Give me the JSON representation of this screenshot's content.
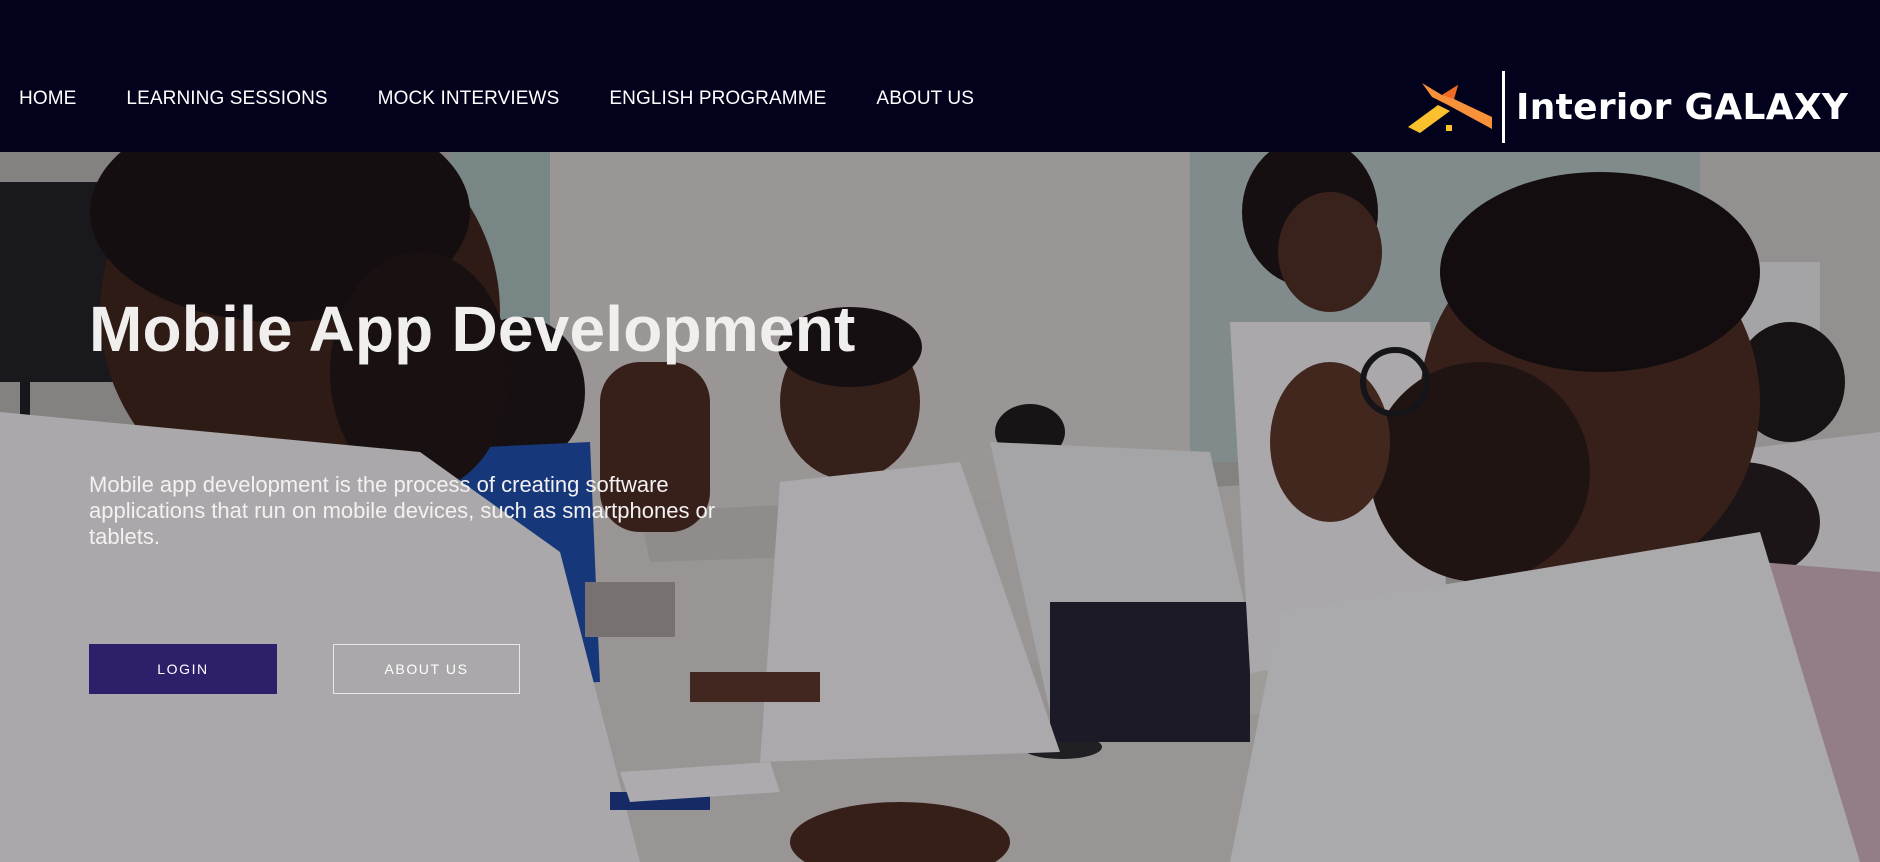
{
  "nav": {
    "items": [
      {
        "label": "HOME"
      },
      {
        "label": "LEARNING SESSIONS"
      },
      {
        "label": "MOCK INTERVIEWS"
      },
      {
        "label": "ENGLISH PROGRAMME"
      },
      {
        "label": "ABOUT US"
      }
    ]
  },
  "brand": {
    "name": "Interior GALAXY",
    "logo_icon": "roof-mark-icon",
    "accent_orange": "#f7923a",
    "accent_yellow": "#fbc02d"
  },
  "hero": {
    "title": "Mobile App Development",
    "description": "Mobile app development is the process of creating software applications that run on mobile devices, such as smartphones or tablets.",
    "login_label": "LOGIN",
    "about_label": "ABOUT US",
    "background_image": "classroom-photo"
  },
  "colors": {
    "header_bg": "#03021c",
    "login_button_bg": "#2f1f6b"
  }
}
